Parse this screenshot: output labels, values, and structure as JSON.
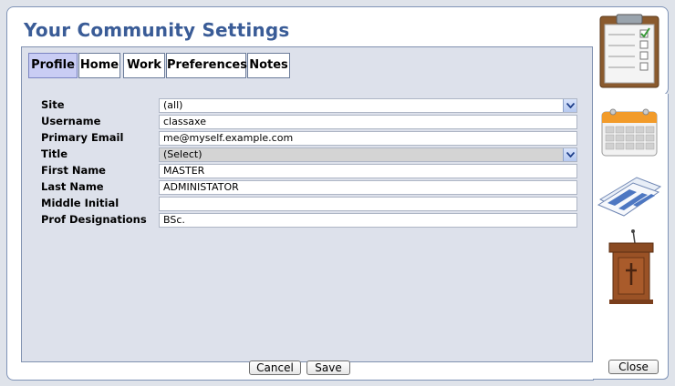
{
  "dialog": {
    "title": "Your Community Settings"
  },
  "tabs": [
    {
      "label": "Profile",
      "active": true
    },
    {
      "label": "Home",
      "active": false
    },
    {
      "label": "Work",
      "active": false
    },
    {
      "label": "Preferences",
      "active": false
    },
    {
      "label": "Notes",
      "active": false
    }
  ],
  "form": {
    "site": {
      "label": "Site",
      "value": "(all)"
    },
    "username": {
      "label": "Username",
      "value": "classaxe"
    },
    "email": {
      "label": "Primary Email",
      "value": "me@myself.example.com"
    },
    "title": {
      "label": "Title",
      "value": "(Select)"
    },
    "first_name": {
      "label": "First Name",
      "value": "MASTER"
    },
    "last_name": {
      "label": "Last Name",
      "value": "ADMINISTATOR"
    },
    "middle_initial": {
      "label": "Middle Initial",
      "value": ""
    },
    "prof_designations": {
      "label": "Prof Designations",
      "value": "BSc."
    }
  },
  "buttons": {
    "cancel": "Cancel",
    "save": "Save",
    "close": "Close"
  },
  "sidebar": {
    "icons": [
      "clipboard-checklist-icon",
      "calendar-icon",
      "newspaper-icon",
      "pulpit-icon"
    ]
  },
  "colors": {
    "title": "#3a5c97",
    "panel_bg": "#dde1eb",
    "active_tab": "#c9cdf4"
  }
}
